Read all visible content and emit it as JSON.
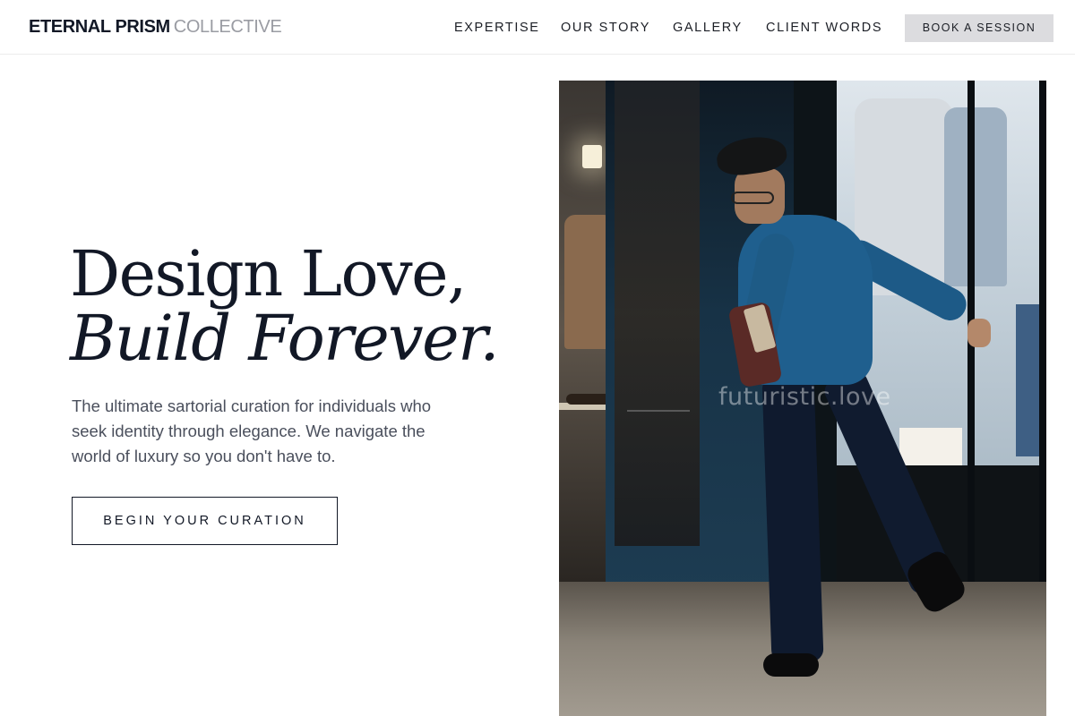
{
  "header": {
    "brand": {
      "strong": "ETERNAL PRISM",
      "light": "COLLECTIVE"
    },
    "nav": [
      {
        "label": "EXPERTISE"
      },
      {
        "label": "OUR STORY"
      },
      {
        "label": "GALLERY"
      },
      {
        "label": "CLIENT WORDS"
      }
    ],
    "book_label": "BOOK A SESSION"
  },
  "hero": {
    "headline_line1": "Design Love,",
    "headline_line2": "Build Forever.",
    "subtext": "The ultimate sartorial curation for individuals who seek identity through elegance. We navigate the world of luxury so you don't have to.",
    "cta_label": "BEGIN YOUR CURATION",
    "image": {
      "watermark": "futuristic.love"
    }
  },
  "colors": {
    "ink": "#121826",
    "muted": "#9a9ca3",
    "body_text": "#4a4f5c",
    "book_button_bg": "#dcdcdf",
    "accent_blue": "#1f5f8e"
  }
}
